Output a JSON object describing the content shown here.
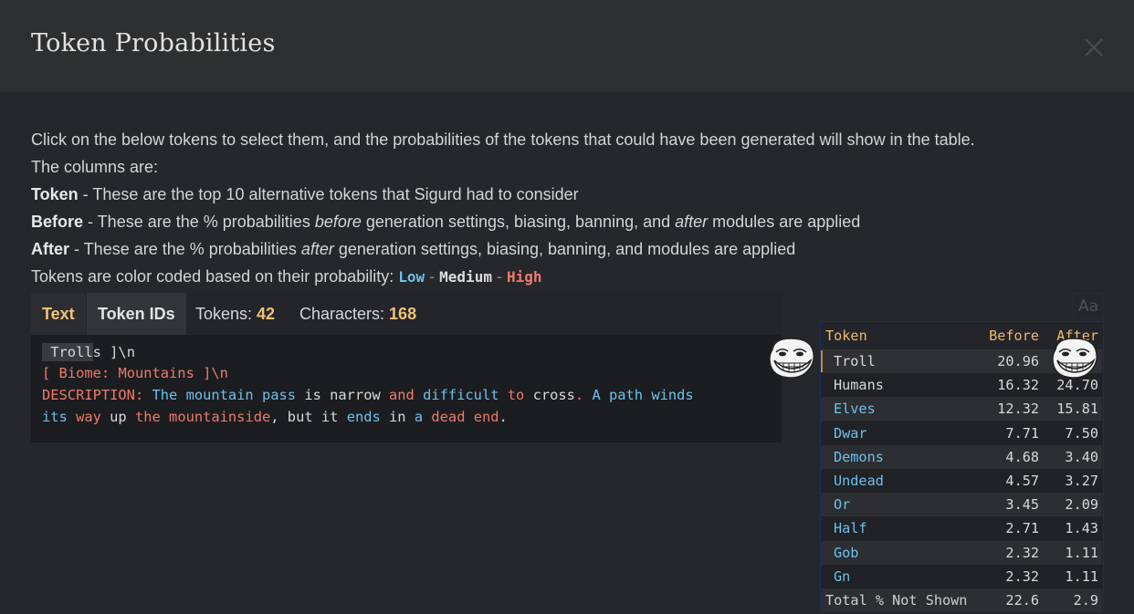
{
  "dialog": {
    "title": "Token Probabilities"
  },
  "intro": {
    "line1": "Click on the below tokens to select them, and the probabilities of the tokens that could have been generated will show in the table.",
    "line2": "The columns are:",
    "token_label": "Token",
    "token_desc": " - These are the top 10 alternative tokens that Sigurd had to consider",
    "before_label": "Before",
    "before_desc_1": " - These are the % probabilities ",
    "before_desc_em": "before",
    "before_desc_2": " generation settings, biasing, banning, and ",
    "before_desc_em2": "after",
    "before_desc_3": " modules are applied",
    "after_label": "After",
    "after_desc_1": " - These are the % probabilities ",
    "after_desc_em": "after",
    "after_desc_2": " generation settings, biasing, banning, and modules are applied",
    "legend_prefix": "Tokens are color coded based on their probability: ",
    "legend_low": "Low",
    "legend_medium": "Medium",
    "legend_high": "High",
    "legend_sep": " - "
  },
  "tabs": {
    "text": "Text",
    "token_ids": "Token IDs",
    "tokens_label": "Tokens: ",
    "tokens_count": "42",
    "characters_label": "Characters: ",
    "characters_count": "168"
  },
  "text_view": {
    "selected_token": " Troll",
    "lines": [
      [
        {
          "t": "s",
          "c": "med"
        },
        {
          "t": " ]\\n",
          "c": "med"
        }
      ],
      [
        {
          "t": "[",
          "c": "high"
        },
        {
          "t": " Biome",
          "c": "high"
        },
        {
          "t": ":",
          "c": "high"
        },
        {
          "t": " Mountains",
          "c": "high"
        },
        {
          "t": " ]\\n",
          "c": "high"
        }
      ],
      [
        {
          "t": "DESCRIPTION",
          "c": "high"
        },
        {
          "t": ":",
          "c": "high"
        },
        {
          "t": " The",
          "c": "low"
        },
        {
          "t": " mountain",
          "c": "low"
        },
        {
          "t": " pass",
          "c": "low"
        },
        {
          "t": " is",
          "c": "med"
        },
        {
          "t": " narrow",
          "c": "med"
        },
        {
          "t": " and",
          "c": "high"
        },
        {
          "t": " difficult",
          "c": "low"
        },
        {
          "t": " to",
          "c": "high"
        },
        {
          "t": " cross",
          "c": "med"
        },
        {
          "t": ".",
          "c": "high"
        },
        {
          "t": " A",
          "c": "low"
        },
        {
          "t": " path",
          "c": "low"
        },
        {
          "t": " winds",
          "c": "low"
        }
      ],
      [
        {
          "t": "its",
          "c": "low"
        },
        {
          "t": " way",
          "c": "high"
        },
        {
          "t": " up",
          "c": "med"
        },
        {
          "t": " the",
          "c": "high"
        },
        {
          "t": " mountainside",
          "c": "high"
        },
        {
          "t": ",",
          "c": "med"
        },
        {
          "t": " but",
          "c": "med"
        },
        {
          "t": " it",
          "c": "med"
        },
        {
          "t": " ends",
          "c": "low"
        },
        {
          "t": " in",
          "c": "med"
        },
        {
          "t": " a",
          "c": "low"
        },
        {
          "t": " dead",
          "c": "high"
        },
        {
          "t": " end",
          "c": "high"
        },
        {
          "t": ".",
          "c": "med"
        }
      ]
    ]
  },
  "font_toggle": "Aa",
  "prob_table": {
    "headers": {
      "token": "Token",
      "before": "Before",
      "after": "After"
    },
    "rows": [
      {
        "token": "Troll",
        "before": "20.96",
        "after": "",
        "color": "white",
        "selected": true
      },
      {
        "token": "Humans",
        "before": "16.32",
        "after": "24.70",
        "color": "white"
      },
      {
        "token": "Elves",
        "before": "12.32",
        "after": "15.81",
        "color": "blue"
      },
      {
        "token": "Dwar",
        "before": "7.71",
        "after": "7.50",
        "color": "blue"
      },
      {
        "token": "Demons",
        "before": "4.68",
        "after": "3.40",
        "color": "blue"
      },
      {
        "token": "Undead",
        "before": "4.57",
        "after": "3.27",
        "color": "blue"
      },
      {
        "token": "Or",
        "before": "3.45",
        "after": "2.09",
        "color": "blue"
      },
      {
        "token": "Half",
        "before": "2.71",
        "after": "1.43",
        "color": "blue"
      },
      {
        "token": "Gob",
        "before": "2.32",
        "after": "1.11",
        "color": "blue"
      },
      {
        "token": "Gn",
        "before": "2.32",
        "after": "1.11",
        "color": "blue"
      }
    ],
    "footer": {
      "label": "Total % Not Shown",
      "before": "22.6",
      "after": "2.9"
    }
  },
  "icons": {
    "close": "close-icon",
    "troll_face": "troll-face-icon"
  }
}
